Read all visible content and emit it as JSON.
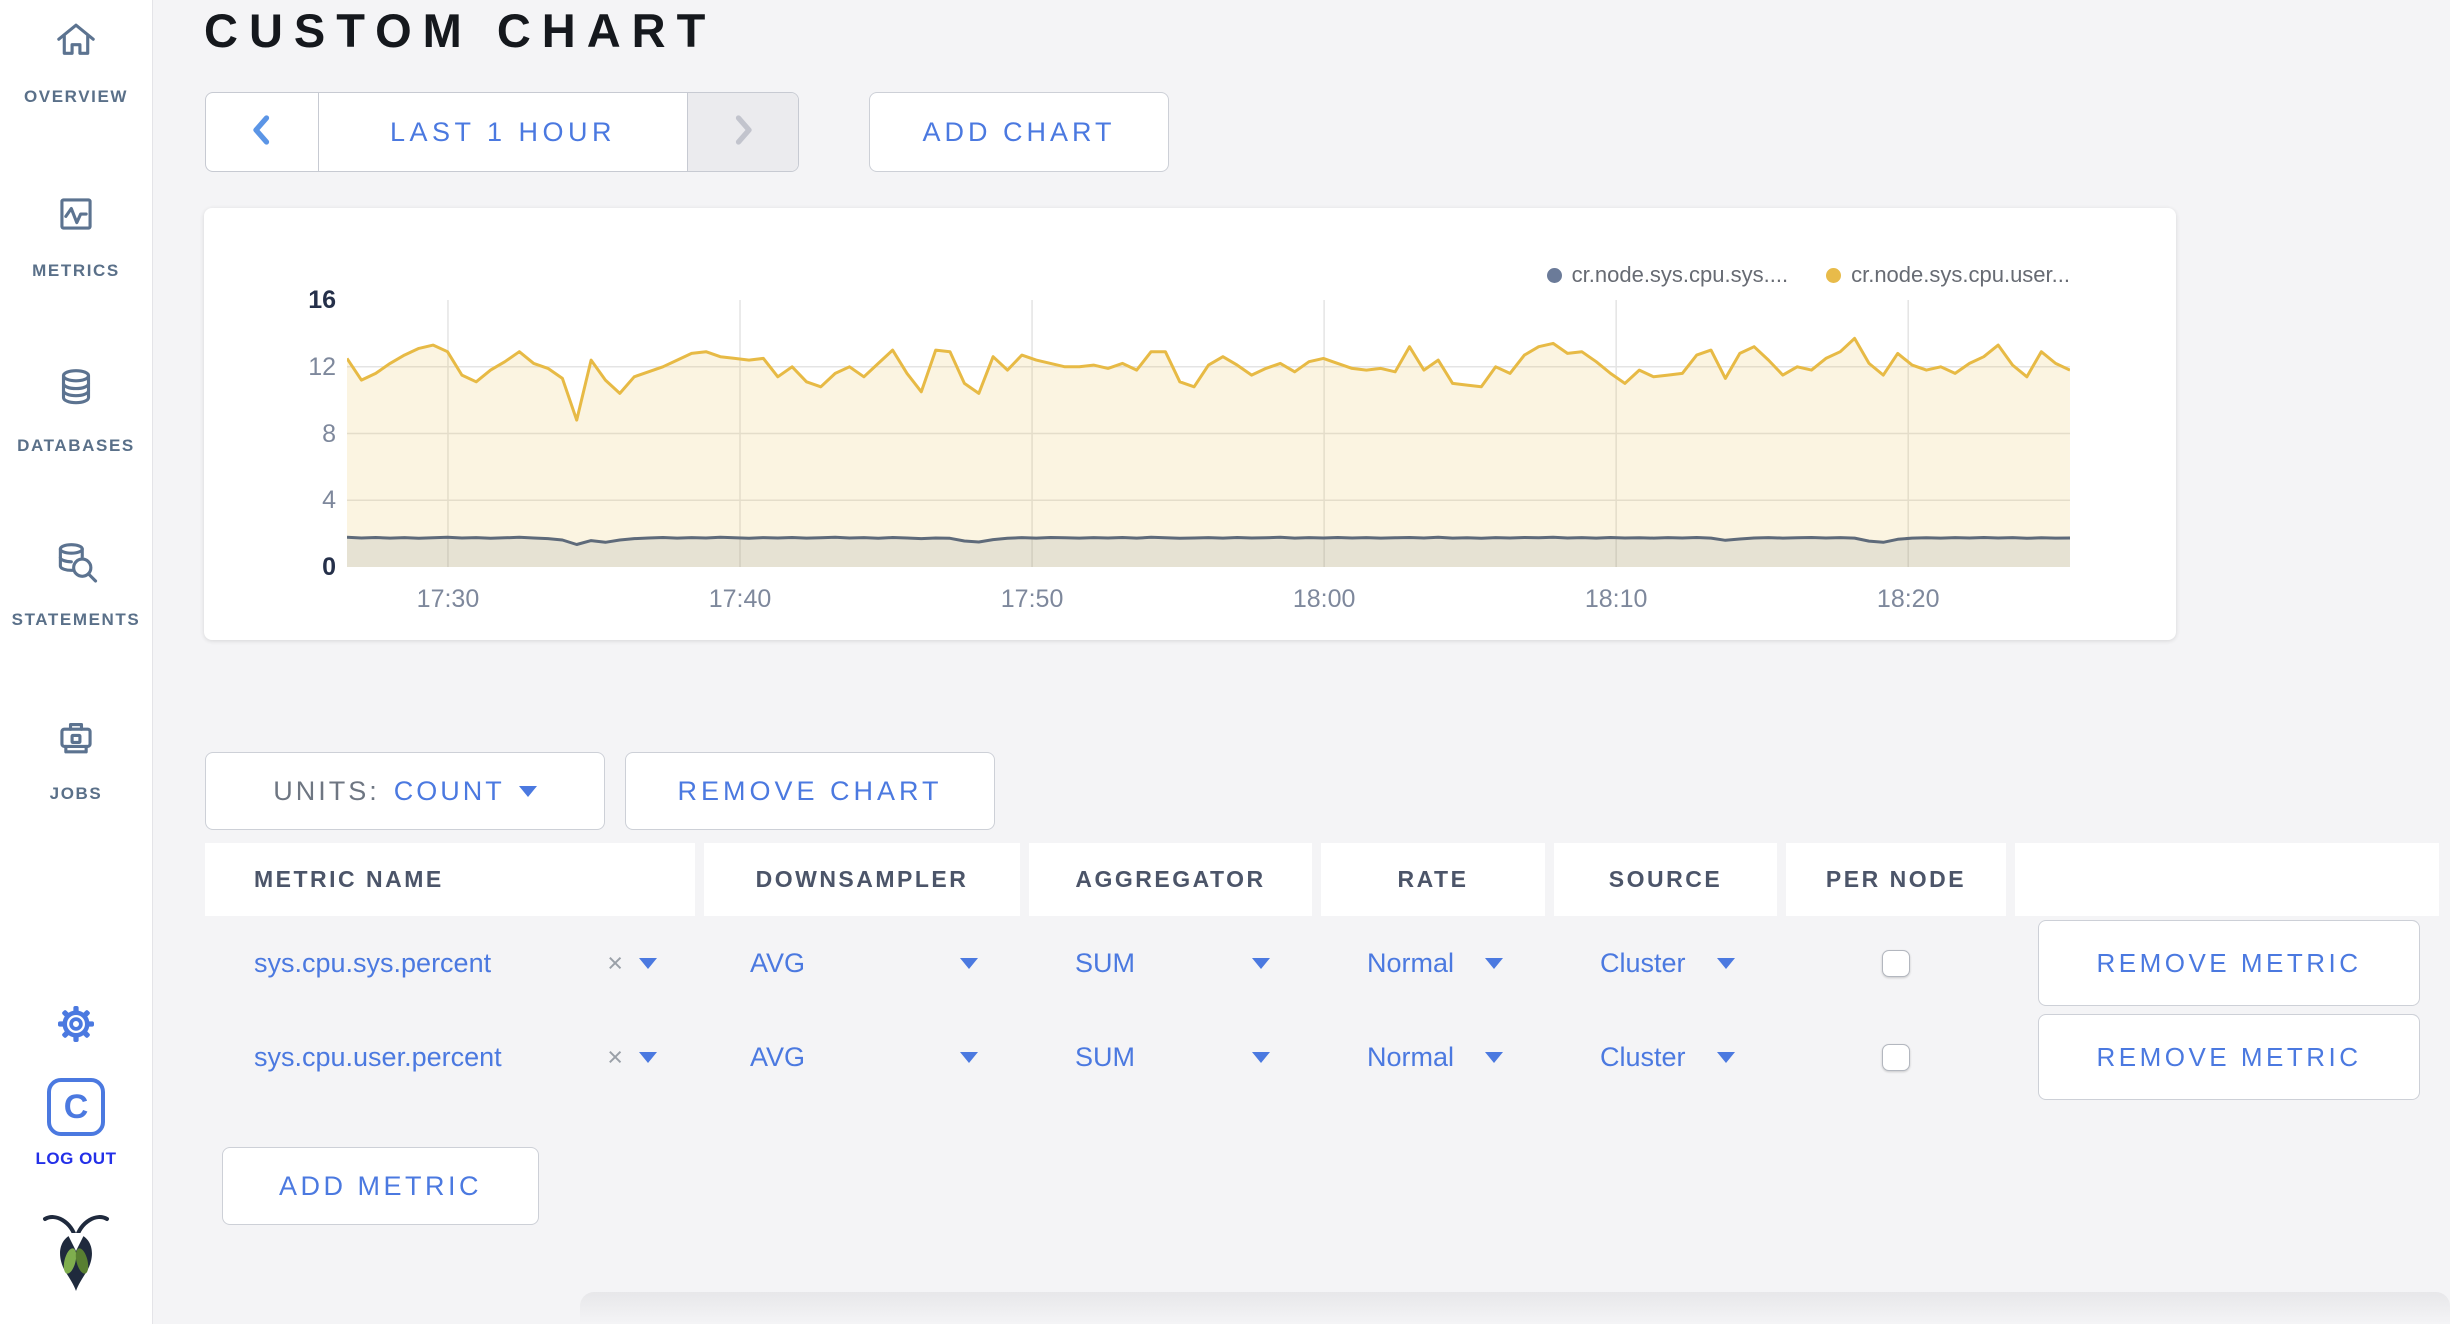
{
  "header": {
    "title": "CUSTOM CHART"
  },
  "sidebar": {
    "items": [
      {
        "id": "overview",
        "label": "OVERVIEW",
        "icon": "home-icon"
      },
      {
        "id": "metrics",
        "label": "METRICS",
        "icon": "metrics-icon"
      },
      {
        "id": "databases",
        "label": "DATABASES",
        "icon": "databases-icon"
      },
      {
        "id": "statements",
        "label": "STATEMENTS",
        "icon": "statements-icon"
      },
      {
        "id": "jobs",
        "label": "JOBS",
        "icon": "jobs-icon"
      }
    ],
    "settings_icon": "gear-icon",
    "logout": {
      "logo_letter": "C",
      "label": "LOG OUT"
    },
    "brand_icon": "cockroach-icon"
  },
  "controls": {
    "time_range": "LAST 1 HOUR",
    "add_chart": "ADD CHART"
  },
  "chart_controls": {
    "units_label": "UNITS:",
    "units_value": "COUNT",
    "remove_chart": "REMOVE CHART",
    "add_metric": "ADD METRIC"
  },
  "chart_data": {
    "type": "line",
    "title": "",
    "xlabel": "",
    "ylabel": "",
    "ylim": [
      0,
      16
    ],
    "grid": true,
    "legend_position": "top-right",
    "y_ticks": [
      "16",
      "12",
      "8",
      "4",
      "0"
    ],
    "y_tick_values": [
      16,
      12,
      8,
      4,
      0
    ],
    "x_ticks": [
      "17:30",
      "17:40",
      "17:50",
      "18:00",
      "18:10",
      "18:20"
    ],
    "x_tick_fractions": [
      0.0586,
      0.2281,
      0.3976,
      0.5671,
      0.7366,
      0.9061
    ],
    "gridline_values": [
      4,
      8,
      12
    ],
    "series": [
      {
        "name": "cr.node.sys.cpu.sys....",
        "color": "#5e6a7a",
        "dot": "#6b7b99",
        "fill": "rgba(94,106,122,0.13)",
        "values": [
          1.78,
          1.74,
          1.77,
          1.73,
          1.76,
          1.72,
          1.75,
          1.78,
          1.74,
          1.76,
          1.72,
          1.75,
          1.78,
          1.74,
          1.7,
          1.62,
          1.35,
          1.58,
          1.48,
          1.62,
          1.7,
          1.74,
          1.77,
          1.73,
          1.76,
          1.74,
          1.78,
          1.75,
          1.72,
          1.76,
          1.74,
          1.77,
          1.73,
          1.75,
          1.78,
          1.74,
          1.76,
          1.72,
          1.77,
          1.74,
          1.7,
          1.74,
          1.72,
          1.56,
          1.5,
          1.64,
          1.72,
          1.76,
          1.73,
          1.77,
          1.75,
          1.73,
          1.76,
          1.74,
          1.77,
          1.73,
          1.78,
          1.75,
          1.72,
          1.74,
          1.76,
          1.73,
          1.77,
          1.74,
          1.75,
          1.78,
          1.73,
          1.76,
          1.74,
          1.77,
          1.74,
          1.76,
          1.73,
          1.75,
          1.77,
          1.74,
          1.78,
          1.73,
          1.75,
          1.72,
          1.76,
          1.74,
          1.77,
          1.75,
          1.78,
          1.74,
          1.76,
          1.73,
          1.77,
          1.74,
          1.75,
          1.73,
          1.76,
          1.74,
          1.77,
          1.73,
          1.6,
          1.68,
          1.74,
          1.76,
          1.73,
          1.75,
          1.77,
          1.74,
          1.76,
          1.73,
          1.55,
          1.48,
          1.66,
          1.73,
          1.75,
          1.73,
          1.76,
          1.74,
          1.77,
          1.74,
          1.76,
          1.72,
          1.75,
          1.73,
          1.74
        ]
      },
      {
        "name": "cr.node.sys.cpu.user...",
        "color": "#e7ba45",
        "dot": "#e8bb4a",
        "fill": "rgba(231,186,69,0.16)",
        "values": [
          12.5,
          11.2,
          11.6,
          12.2,
          12.7,
          13.1,
          13.3,
          12.9,
          11.5,
          11.1,
          11.8,
          12.3,
          12.9,
          12.2,
          11.9,
          11.3,
          8.8,
          12.4,
          11.2,
          10.4,
          11.4,
          11.7,
          12.0,
          12.4,
          12.8,
          12.9,
          12.6,
          12.5,
          12.4,
          12.5,
          11.4,
          12.0,
          11.1,
          10.8,
          11.6,
          12.0,
          11.4,
          12.2,
          13.0,
          11.6,
          10.5,
          13.0,
          12.9,
          11.0,
          10.4,
          12.6,
          11.8,
          12.7,
          12.4,
          12.2,
          12.0,
          12.0,
          12.1,
          11.9,
          12.2,
          11.8,
          12.9,
          12.9,
          11.1,
          10.8,
          12.1,
          12.6,
          12.1,
          11.5,
          11.9,
          12.2,
          11.7,
          12.3,
          12.5,
          12.2,
          11.9,
          11.8,
          11.9,
          11.7,
          13.2,
          11.8,
          12.4,
          11.0,
          10.9,
          10.8,
          12.0,
          11.6,
          12.7,
          13.2,
          13.4,
          12.8,
          12.9,
          12.3,
          11.6,
          11.0,
          11.8,
          11.4,
          11.5,
          11.6,
          12.7,
          13.0,
          11.3,
          12.8,
          13.2,
          12.4,
          11.5,
          12.0,
          11.8,
          12.5,
          12.9,
          13.7,
          12.2,
          11.5,
          12.8,
          12.1,
          11.8,
          12.0,
          11.6,
          12.2,
          12.6,
          13.3,
          12.1,
          11.4,
          12.9,
          12.2,
          11.8
        ]
      }
    ]
  },
  "table": {
    "columns": [
      "METRIC NAME",
      "DOWNSAMPLER",
      "AGGREGATOR",
      "RATE",
      "SOURCE",
      "PER NODE",
      ""
    ],
    "clear_glyph": "×",
    "remove_metric_label": "REMOVE METRIC",
    "rows": [
      {
        "metric": "sys.cpu.sys.percent",
        "downsampler": "AVG",
        "aggregator": "SUM",
        "rate": "Normal",
        "source": "Cluster",
        "per_node": false
      },
      {
        "metric": "sys.cpu.user.percent",
        "downsampler": "AVG",
        "aggregator": "SUM",
        "rate": "Normal",
        "source": "Cluster",
        "per_node": false
      }
    ]
  }
}
